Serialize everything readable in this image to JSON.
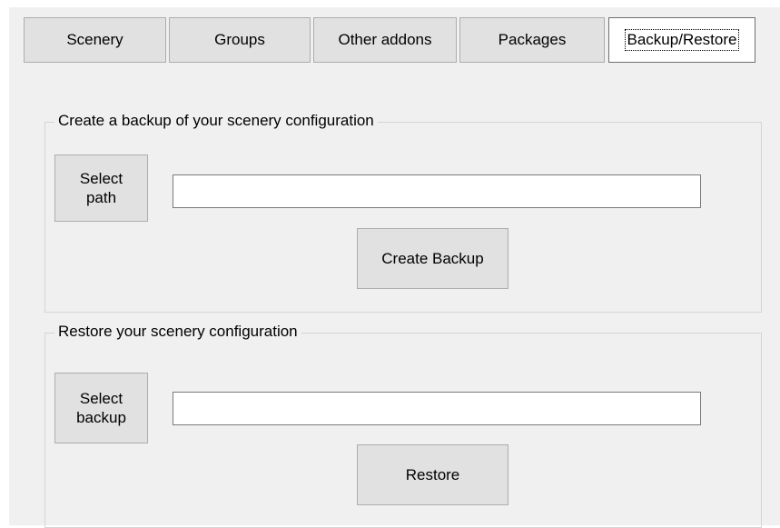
{
  "tabs": [
    {
      "label": "Scenery"
    },
    {
      "label": "Groups"
    },
    {
      "label": "Other addons"
    },
    {
      "label": "Packages"
    },
    {
      "label": "Backup/Restore",
      "active": true
    }
  ],
  "backup_section": {
    "title": "Create a backup of your scenery configuration",
    "select_path_label": "Select\npath",
    "path_value": "",
    "create_button_label": "Create Backup"
  },
  "restore_section": {
    "title": "Restore your scenery configuration",
    "select_backup_label": "Select\nbackup",
    "backup_value": "",
    "restore_button_label": "Restore"
  }
}
